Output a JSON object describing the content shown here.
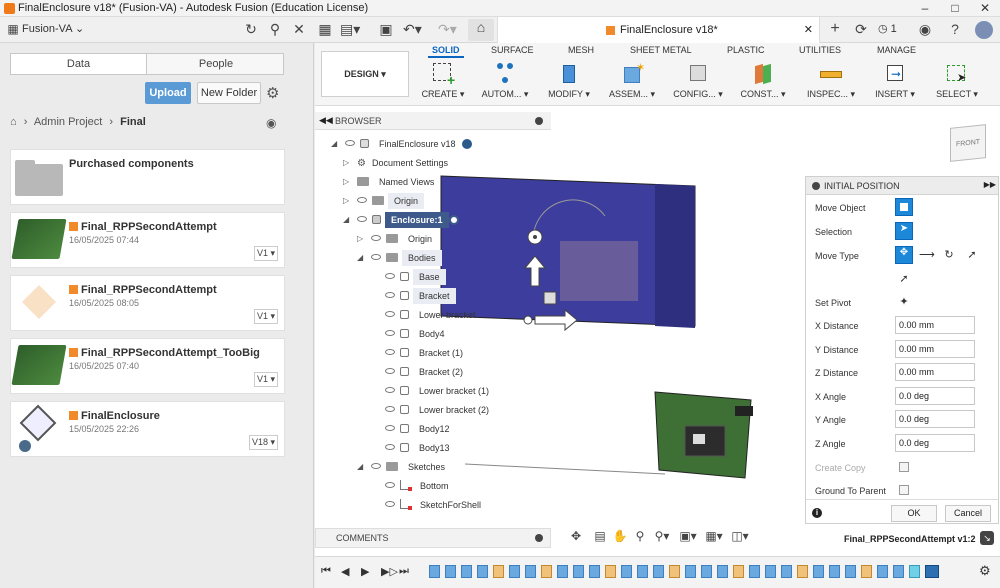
{
  "window": {
    "title": "FinalEnclosure v18* (Fusion-VA) - Autodesk Fusion (Education License)"
  },
  "app_toolbar": {
    "team": "Fusion-VA",
    "notifications": "1"
  },
  "data_panel": {
    "tabs": [
      "Data",
      "People"
    ],
    "upload": "Upload",
    "new_folder": "New Folder",
    "breadcrumb": [
      "Admin Project",
      "Final"
    ],
    "items": [
      {
        "name": "Purchased components",
        "date": "",
        "version": ""
      },
      {
        "name": "Final_RPPSecondAttempt",
        "date": "16/05/2025 07:44",
        "version": "V1 ▾"
      },
      {
        "name": "Final_RPPSecondAttempt",
        "date": "16/05/2025 08:05",
        "version": "V1 ▾"
      },
      {
        "name": "Final_RPPSecondAttempt_TooBig",
        "date": "16/05/2025 07:40",
        "version": "V1 ▾"
      },
      {
        "name": "FinalEnclosure",
        "date": "15/05/2025 22:26",
        "version": "V18 ▾"
      }
    ]
  },
  "document_tab": {
    "title": "FinalEnclosure v18*"
  },
  "ribbon": {
    "design": "DESIGN ▾",
    "tabs": [
      "SOLID",
      "SURFACE",
      "MESH",
      "SHEET METAL",
      "PLASTIC",
      "UTILITIES",
      "MANAGE"
    ],
    "tools": [
      "CREATE ▾",
      "AUTOM... ▾",
      "MODIFY ▾",
      "ASSEM... ▾",
      "CONFIG... ▾",
      "CONST... ▾",
      "INSPEC... ▾",
      "INSERT ▾",
      "SELECT ▾"
    ]
  },
  "browser": {
    "title": "BROWSER",
    "root": "FinalEnclosure v18",
    "nodes": [
      "Document Settings",
      "Named Views",
      "Origin",
      "Enclosure:1",
      "Origin",
      "Bodies",
      "Base",
      "Bracket",
      "Lower bracket",
      "Body4",
      "Bracket (1)",
      "Bracket (2)",
      "Lower bracket (1)",
      "Lower bracket (2)",
      "Body12",
      "Body13",
      "Sketches",
      "Bottom",
      "SketchForShell"
    ]
  },
  "comments": {
    "title": "COMMENTS"
  },
  "view_cube": {
    "face": "FRONT"
  },
  "initial_position": {
    "title": "INITIAL POSITION",
    "labels": [
      "Move Object",
      "Selection",
      "Move Type",
      "Set Pivot",
      "X Distance",
      "Y Distance",
      "Z Distance",
      "X Angle",
      "Y Angle",
      "Z Angle",
      "Create Copy",
      "Ground To Parent"
    ],
    "values": {
      "x_distance": "0.00 mm",
      "y_distance": "0.00 mm",
      "z_distance": "0.00 mm",
      "x_angle": "0.0 deg",
      "y_angle": "0.0 deg",
      "z_angle": "0.0 deg"
    },
    "ok": "OK",
    "cancel": "Cancel"
  },
  "status": {
    "document": "Final_RPPSecondAttempt v1:2"
  },
  "colors": {
    "accent": "#0a66c2",
    "upload_button": "#5b9bd5",
    "selected_node": "#3d5a8a",
    "enclosure": "#3f3fa0"
  }
}
